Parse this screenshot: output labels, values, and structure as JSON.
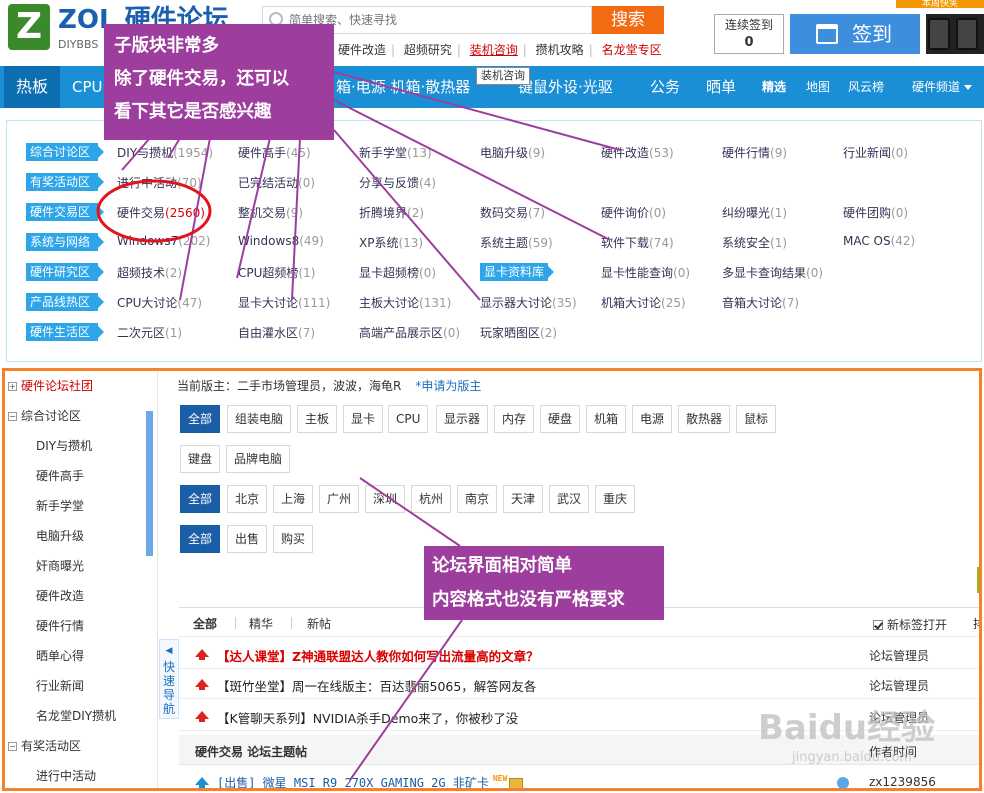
{
  "header": {
    "logo_mark": "Z",
    "logo_brand": "ZOL 硬件论坛",
    "logo_sub": "DIYBBS",
    "search_placeholder": "简单搜索、快速寻找",
    "search_button": "搜索",
    "corner_label": "本周快笑",
    "signin_count_label": "连续签到",
    "signin_count_value": "0",
    "signin_button": "签到"
  },
  "top_links": [
    "硬件改造",
    "超频研究",
    "装机咨询",
    "攒机攻略",
    "名龙堂专区"
  ],
  "tooltip": "装机咨询",
  "nav": {
    "home": "热板",
    "items": [
      "CPU",
      "箱·电源·机箱·散热器",
      "键鼠外设·光驱",
      "公务",
      "晒单",
      "精选",
      "地图",
      "风云榜",
      "硬件频道"
    ]
  },
  "categories": [
    "综合讨论区",
    "有奖活动区",
    "硬件交易区",
    "系统与网络",
    "硬件研究区",
    "产品线热区",
    "硬件生活区"
  ],
  "boards": [
    [
      {
        "name": "DIY与攒机",
        "count": "(1954)"
      },
      {
        "name": "硬件高手",
        "count": "(45)"
      },
      {
        "name": "新手学堂",
        "count": "(13)"
      },
      {
        "name": "电脑升级",
        "count": "(9)"
      },
      {
        "name": "硬件改造",
        "count": "(53)"
      },
      {
        "name": "硬件行情",
        "count": "(9)"
      },
      {
        "name": "行业新闻",
        "count": "(0)"
      }
    ],
    [
      {
        "name": "进行中活动",
        "count": "(70)"
      },
      {
        "name": "已完结活动",
        "count": "(0)"
      },
      {
        "name": "分享与反馈",
        "count": "(4)"
      }
    ],
    [
      {
        "name": "硬件交易",
        "count": "(2560)"
      },
      {
        "name": "整机交易",
        "count": "(9)"
      },
      {
        "name": "折腾境界",
        "count": "(2)"
      },
      {
        "name": "数码交易",
        "count": "(7)"
      },
      {
        "name": "硬件询价",
        "count": "(0)"
      },
      {
        "name": "纠纷曝光",
        "count": "(1)"
      },
      {
        "name": "硬件团购",
        "count": "(0)"
      }
    ],
    [
      {
        "name": "Windows7",
        "count": "(202)"
      },
      {
        "name": "Windows8",
        "count": "(49)"
      },
      {
        "name": "XP系统",
        "count": "(13)"
      },
      {
        "name": "系统主题",
        "count": "(59)"
      },
      {
        "name": "软件下载",
        "count": "(74)"
      },
      {
        "name": "系统安全",
        "count": "(1)"
      },
      {
        "name": "MAC OS",
        "count": "(42)"
      }
    ],
    [
      {
        "name": "超频技术",
        "count": "(2)"
      },
      {
        "name": "CPU超频榜",
        "count": "(1)"
      },
      {
        "name": "显卡超频榜",
        "count": "(0)"
      },
      {
        "name": "显卡资料库",
        "count": ""
      },
      {
        "name": "显卡性能查询",
        "count": "(0)"
      },
      {
        "name": "多显卡查询结果",
        "count": "(0)"
      }
    ],
    [
      {
        "name": "CPU大讨论",
        "count": "(47)"
      },
      {
        "name": "显卡大讨论",
        "count": "(111)"
      },
      {
        "name": "主板大讨论",
        "count": "(131)"
      },
      {
        "name": "显示器大讨论",
        "count": "(35)"
      },
      {
        "name": "机箱大讨论",
        "count": "(25)"
      },
      {
        "name": "音箱大讨论",
        "count": "(7)"
      }
    ],
    [
      {
        "name": "二次元区",
        "count": "(1)"
      },
      {
        "name": "自由灌水区",
        "count": "(7)"
      },
      {
        "name": "高端产品展示区",
        "count": "(0)"
      },
      {
        "name": "玩家晒图区",
        "count": "(2)"
      }
    ]
  ],
  "sidebar": [
    "硬件论坛社团",
    "综合讨论区",
    "DIY与攒机",
    "硬件高手",
    "新手学堂",
    "电脑升级",
    "奸商曝光",
    "硬件改造",
    "硬件行情",
    "晒单心得",
    "行业新闻",
    "名龙堂DIY攒机",
    "有奖活动区",
    "进行中活动"
  ],
  "quick_nav": "快速导航",
  "moderators": {
    "text": "当前版主：二手市场管理员，波波，海龟R",
    "apply": "*申请为版主"
  },
  "filters": {
    "types": [
      "全部",
      "组装电脑",
      "主板",
      "显卡",
      "CPU",
      "显示器",
      "内存",
      "硬盘",
      "机箱",
      "电源",
      "散热器",
      "鼠标",
      "键盘",
      "品牌电脑"
    ],
    "cities": [
      "全部",
      "北京",
      "上海",
      "广州",
      "深圳",
      "杭州",
      "南京",
      "天津",
      "武汉",
      "重庆"
    ],
    "trade": [
      "全部",
      "出售",
      "购买"
    ]
  },
  "tabs": {
    "all": "全部",
    "digest": "精华",
    "newest": "新帖",
    "new_tab": "新标签打开",
    "more": "排"
  },
  "threads": [
    {
      "title": "【达人课堂】Z神通联盟达人教你如何写出流量高的文章？",
      "author": "论坛管理员"
    },
    {
      "title": "【斑竹坐堂】周一在线版主：百达翡丽5065，解答网友各",
      "author": "论坛管理员"
    },
    {
      "title": "【K管聊天系列】NVIDIA杀手Demo来了，你被秒了没",
      "author": "论坛管理员"
    }
  ],
  "threads_head": {
    "left": "硬件交易 论坛主题帖",
    "right": "作者时间"
  },
  "last_thread": {
    "title": "[出售] 微星 MSI R9 270X GAMING 2G 非矿卡",
    "new": "NEW",
    "author": "zx1239856"
  },
  "notes": {
    "note1": [
      "子版块非常多",
      "除了硬件交易，还可以",
      "看下其它是否感兴趣"
    ],
    "note2": [
      "论坛界面相对简单",
      "内容格式也没有严格要求"
    ]
  },
  "watermark": {
    "w1": "Baidu经验",
    "w2": "jingyan.baidu.com"
  },
  "colors": {
    "nav": "#1b8fd6",
    "category": "#2ea5e8",
    "note": "#9d3e9e",
    "frame": "#f5822a",
    "search_button": "#f26a12"
  }
}
